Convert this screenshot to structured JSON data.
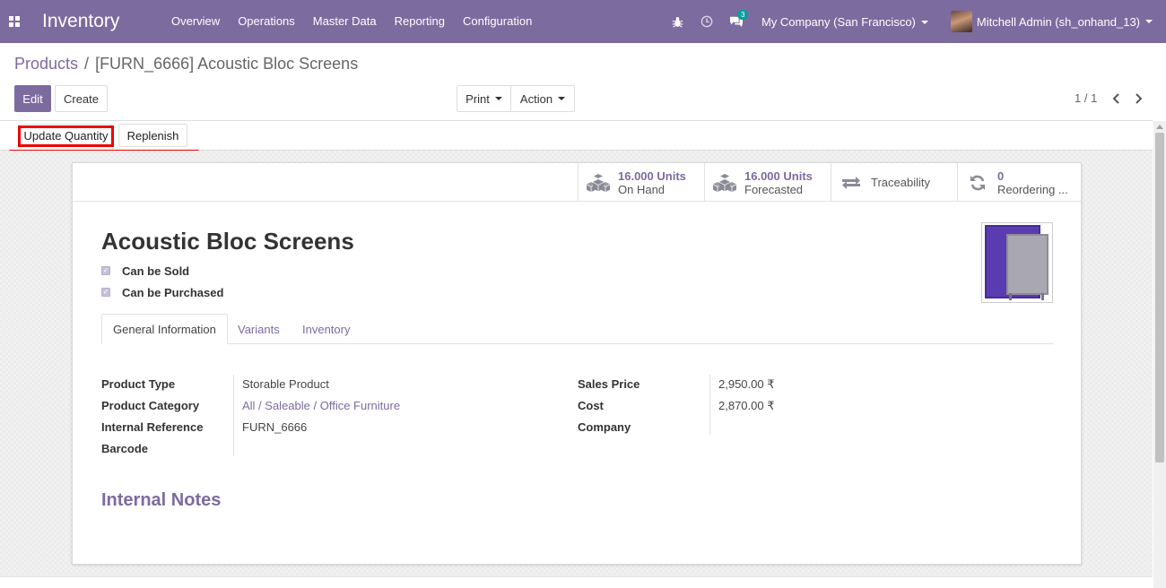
{
  "navbar": {
    "app_name": "Inventory",
    "menu": [
      "Overview",
      "Operations",
      "Master Data",
      "Reporting",
      "Configuration"
    ],
    "messages_count": "3",
    "company": "My Company (San Francisco)",
    "user": "Mitchell Admin (sh_onhand_13)"
  },
  "breadcrumb": {
    "parent": "Products",
    "separator": "/",
    "current": "[FURN_6666] Acoustic Bloc Screens"
  },
  "control": {
    "edit_label": "Edit",
    "create_label": "Create",
    "print_label": "Print",
    "action_label": "Action",
    "pager": "1 / 1"
  },
  "statusbar": {
    "update_qty_label": "Update Quantity",
    "replenish_label": "Replenish"
  },
  "smart_buttons": [
    {
      "value": "16.000 Units",
      "label": "On Hand",
      "icon": "cubes-icon"
    },
    {
      "value": "16.000 Units",
      "label": "Forecasted",
      "icon": "cubes-icon"
    },
    {
      "value": "",
      "label": "Traceability",
      "icon": "exchange-icon"
    },
    {
      "value": "0",
      "label": "Reordering ...",
      "icon": "refresh-icon"
    }
  ],
  "product": {
    "name": "Acoustic Bloc Screens",
    "can_be_sold_label": "Can be Sold",
    "can_be_purchased_label": "Can be Purchased"
  },
  "tabs": [
    "General Information",
    "Variants",
    "Inventory"
  ],
  "fields_left": [
    {
      "label": "Product Type",
      "value": "Storable Product"
    },
    {
      "label": "Product Category",
      "value": "All / Saleable / Office Furniture"
    },
    {
      "label": "Internal Reference",
      "value": "FURN_6666"
    },
    {
      "label": "Barcode",
      "value": ""
    }
  ],
  "fields_right": [
    {
      "label": "Sales Price",
      "value": "2,950.00 ₹"
    },
    {
      "label": "Cost",
      "value": "2,870.00 ₹"
    },
    {
      "label": "Company",
      "value": ""
    }
  ],
  "internal_notes_title": "Internal Notes",
  "colors": {
    "brand": "#7c6b9f",
    "highlight": "#e00000",
    "badge": "#00a09d"
  }
}
